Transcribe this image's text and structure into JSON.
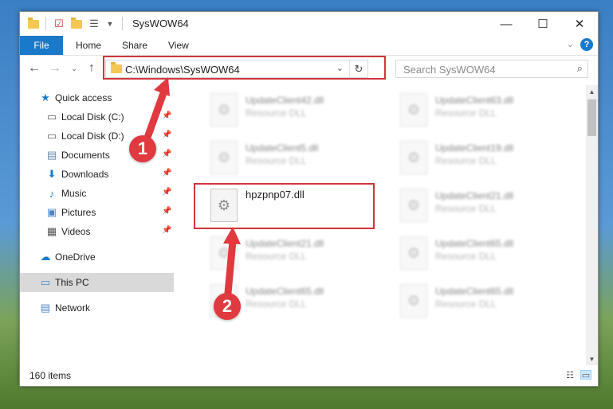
{
  "window": {
    "title": "SysWOW64",
    "controls": {
      "minimize": "—",
      "maximize": "☐",
      "close": "✕"
    }
  },
  "ribbon": {
    "tabs": [
      "File",
      "Home",
      "Share",
      "View"
    ],
    "help": "?"
  },
  "navigation": {
    "address": "C:\\Windows\\SysWOW64",
    "search_placeholder": "Search SysWOW64"
  },
  "sidebar": {
    "quick_access": "Quick access",
    "pinned": [
      {
        "label": "Local Disk (C:)",
        "icon": "drive-icon"
      },
      {
        "label": "Local Disk (D:)",
        "icon": "drive-icon"
      },
      {
        "label": "Documents",
        "icon": "documents-icon"
      },
      {
        "label": "Downloads",
        "icon": "downloads-icon"
      },
      {
        "label": "Music",
        "icon": "music-icon"
      },
      {
        "label": "Pictures",
        "icon": "pictures-icon"
      },
      {
        "label": "Videos",
        "icon": "videos-icon"
      }
    ],
    "onedrive": "OneDrive",
    "this_pc": "This PC",
    "network": "Network"
  },
  "files": [
    {
      "name": "UpdateClient42.dll",
      "type": "Resource DLL"
    },
    {
      "name": "UpdateClient63.dll",
      "type": "Resource DLL"
    },
    {
      "name": "UpdateClient5.dll",
      "type": "Resource DLL"
    },
    {
      "name": "UpdateClient19.dll",
      "type": "Resource DLL"
    },
    {
      "name": "hpzpnp07.dll",
      "type": ""
    },
    {
      "name": "UpdateClient21.dll",
      "type": "Resource DLL"
    },
    {
      "name": "UpdateClient21.dll",
      "type": "Resource DLL"
    },
    {
      "name": "UpdateClient65.dll",
      "type": "Resource DLL"
    },
    {
      "name": "UpdateClient65.dll",
      "type": "Resource DLL"
    },
    {
      "name": "UpdateClient65.dll",
      "type": "Resource DLL"
    }
  ],
  "status": {
    "item_count": "160 items"
  },
  "annotations": {
    "step1": "1",
    "step2": "2",
    "color": "#d0353b"
  }
}
